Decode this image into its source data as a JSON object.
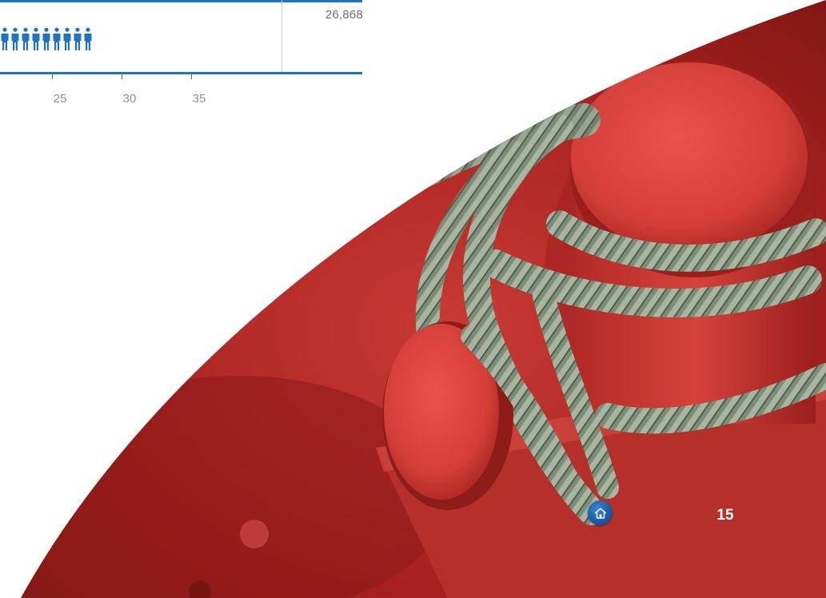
{
  "chart_data": {
    "type": "pictogram",
    "total_value": "26,868",
    "x_tick_labels": [
      "25",
      "30",
      "35"
    ],
    "icon": "person-icon",
    "icon_color": "#1f73c4"
  },
  "photo": {
    "icon": "mooring-bollard-photo"
  },
  "footer": {
    "home_icon": "home-icon",
    "page_number": "15"
  },
  "colors": {
    "accent": "#1f73c4",
    "tick_text": "#8d9094",
    "value_text": "#6c7075",
    "bollard_red": "#c8302c",
    "rope": "#8a9a7e"
  }
}
